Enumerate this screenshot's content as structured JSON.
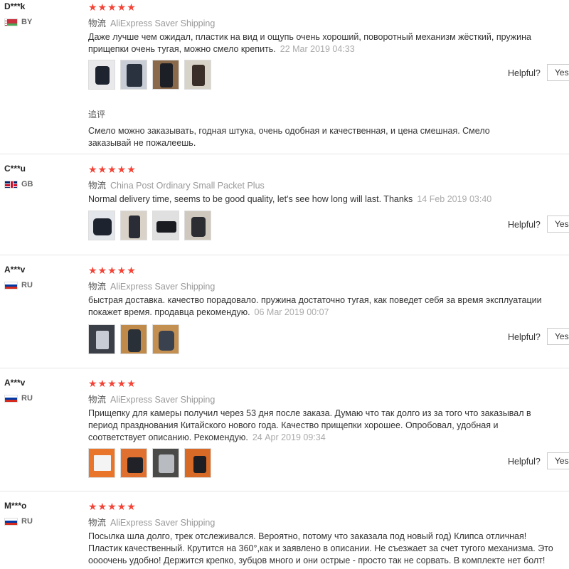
{
  "reviews": [
    {
      "user": "D***k",
      "country": "BY",
      "stars": "★★★★★",
      "shipping_label": "物流",
      "shipping_method": "AliExpress Saver Shipping",
      "text": "Даже лучше чем ожидал, пластик на вид и ощупь очень хороший, поворотный механизм жёсткий, пружина прищепки очень тугая, можно смело крепить.",
      "date": "22 Mar 2019 04:33",
      "helpful_label": "Helpful?",
      "yes_label": "Yes",
      "additional_label": "追评",
      "additional_text": "Смело можно заказывать, годная штука, очень одобная и качественная, и цена смешная. Смело заказывай не пожалеешь."
    },
    {
      "user": "C***u",
      "country": "GB",
      "stars": "★★★★★",
      "shipping_label": "物流",
      "shipping_method": "China Post Ordinary Small Packet Plus",
      "text": "Normal delivery time, seems to be good quality, let's see how long will last. Thanks",
      "date": "14 Feb 2019 03:40",
      "helpful_label": "Helpful?",
      "yes_label": "Yes"
    },
    {
      "user": "A***v",
      "country": "RU",
      "stars": "★★★★★",
      "shipping_label": "物流",
      "shipping_method": "AliExpress Saver Shipping",
      "text": "быстрая доставка. качество порадовало. пружина достаточно тугая, как поведет себя за время эксплуатации покажет время. продавца рекомендую.",
      "date": "06 Mar 2019 00:07",
      "helpful_label": "Helpful?",
      "yes_label": "Yes"
    },
    {
      "user": "A***v",
      "country": "RU",
      "stars": "★★★★★",
      "shipping_label": "物流",
      "shipping_method": "AliExpress Saver Shipping",
      "text": "Прищепку для камеры получил через 53 дня после заказа. Думаю что так долго из за того что заказывал в период празднования Китайского нового года. Качество прищепки хорошее. Опробовал, удобная и соответствует описанию. Рекомендую.",
      "date": "24 Apr 2019 09:34",
      "helpful_label": "Helpful?",
      "yes_label": "Yes"
    },
    {
      "user": "M***o",
      "country": "RU",
      "stars": "★★★★★",
      "shipping_label": "物流",
      "shipping_method": "AliExpress Saver Shipping",
      "text": "Посылка шла долго, трек отслеживался. Вероятно, потому что заказала под новый год) Клипса отличная! Пластик качественный. Крутится на 360°,как и заявлено в описании. Не съезжает за счет тугого механизма. Это оооочень удобно! Держится крепко, зубцов много и они острые - просто так не сорвать. В комплекте нет болт!"
    }
  ],
  "colors": {
    "star": "#f44336",
    "date": "#aaaaaa",
    "muted": "#999999"
  }
}
